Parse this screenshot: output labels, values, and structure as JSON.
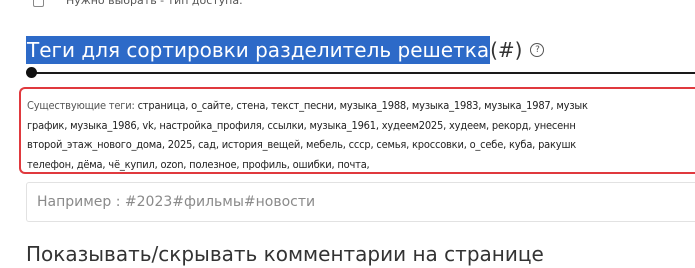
{
  "top_option": {
    "text": "Нужно выбрать - тип доступа."
  },
  "heading": {
    "selected_text": "Теги для сортировки разделитель решетка",
    "rest_text": "(#)",
    "help_glyph": "?"
  },
  "tags": {
    "label": "Существующие теги: ",
    "lines": [
      "страница, о_сайте, стена, текст_песни, музыка_1988, музыка_1983, музыка_1987, музык",
      "график, музыка_1986, vk, настройка_профиля, ссылки, музыка_1961, худеем2025, худеем, рекорд, унесенн",
      "второй_этаж_нового_дома, 2025, сад, история_вещей, мебель, ссср, семья, кроссовки, о_себе, куба, ракушк",
      "телефон, дёма, чё_купил, ozon, полезное, профиль, ошибки, почта,"
    ]
  },
  "tags_input": {
    "value": "",
    "placeholder": "Например : #2023#фильмы#новости"
  },
  "bottom_label": {
    "text": "Показывать/скрывать комментарии на странице"
  },
  "colors": {
    "selection": "#2d6ac8",
    "box_border": "#e0393e"
  },
  "icons": {
    "help": "question-circle-icon",
    "checkbox": "checkbox-icon"
  }
}
